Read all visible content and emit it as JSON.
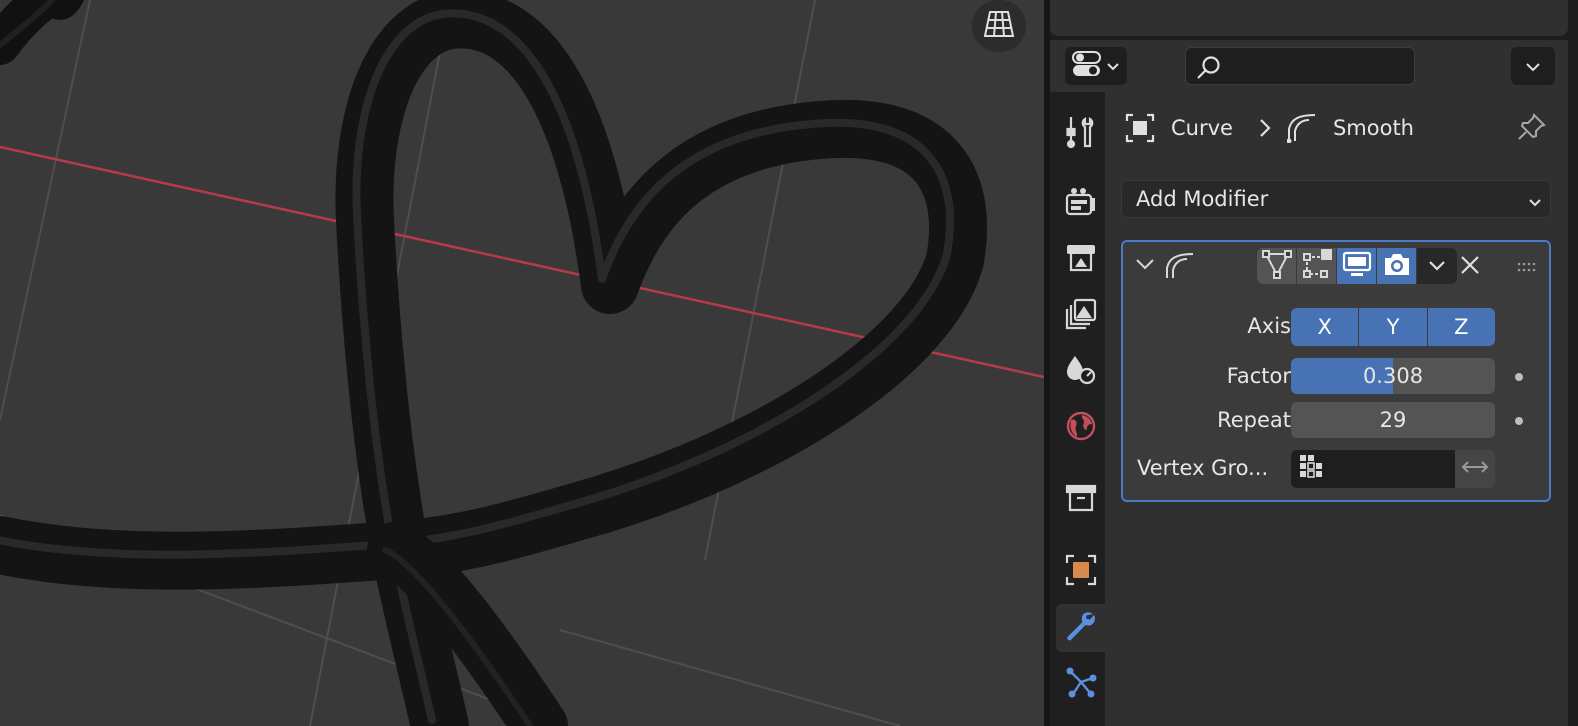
{
  "viewport": {
    "gizmo_icon": "perspective-grid-icon",
    "colors": {
      "background": "#393939",
      "x_axis": "#b63a48",
      "grid": "#4a4a4a",
      "mesh": "#141414"
    }
  },
  "properties": {
    "header": {
      "editor_type_icon": "properties-editor-icon",
      "search_icon": "search-icon",
      "search_value": "",
      "search_placeholder": ""
    },
    "tabs": [
      {
        "name": "tool",
        "icon": "tool-icon",
        "active": false
      },
      {
        "name": "render",
        "icon": "render-icon",
        "active": false
      },
      {
        "name": "output",
        "icon": "output-icon",
        "active": false
      },
      {
        "name": "view-layer",
        "icon": "view-layer-icon",
        "active": false
      },
      {
        "name": "scene",
        "icon": "scene-icon",
        "active": false
      },
      {
        "name": "world",
        "icon": "world-icon",
        "active": false
      },
      {
        "name": "collection",
        "icon": "collection-icon",
        "active": false
      },
      {
        "name": "object",
        "icon": "object-icon",
        "active": false
      },
      {
        "name": "modifiers",
        "icon": "wrench-icon",
        "active": true
      },
      {
        "name": "particles",
        "icon": "particles-icon",
        "active": false
      }
    ],
    "breadcrumb": {
      "object": "Curve",
      "separator": ">",
      "modifier": "Smooth"
    },
    "add_modifier_label": "Add Modifier",
    "modifier": {
      "name": "Smooth",
      "axis_label": "Axis",
      "axis": [
        "X",
        "Y",
        "Z"
      ],
      "factor_label": "Factor",
      "factor_value": "0.308",
      "factor_fraction": 0.5,
      "repeat_label": "Repeat",
      "repeat_value": "29",
      "vertex_group_label": "Vertex Gro...",
      "vertex_group_value": ""
    },
    "colors": {
      "accent": "#4772b3",
      "panel_border": "#4d79c7"
    }
  }
}
